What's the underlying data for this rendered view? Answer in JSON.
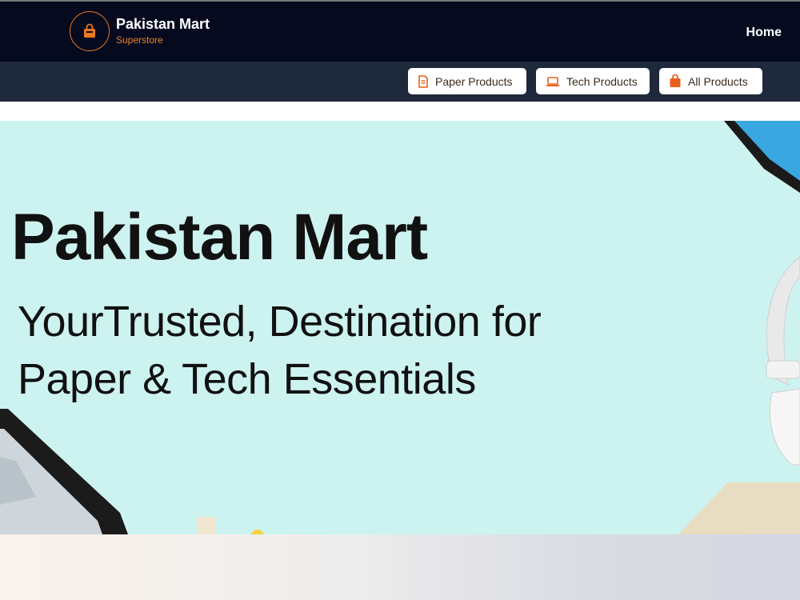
{
  "brand": {
    "name": "Pakistan Mart",
    "tagline": "Superstore",
    "logo_icon": "shopping-bag-icon",
    "accent_color": "#f0851f"
  },
  "nav": {
    "home_label": "Home"
  },
  "categories": [
    {
      "label": "Paper Products",
      "icon": "document-icon"
    },
    {
      "label": "Tech Products",
      "icon": "laptop-icon"
    },
    {
      "label": "All Products",
      "icon": "shopping-bag-icon"
    }
  ],
  "hero": {
    "title": "Pakistan Mart",
    "line1": "YourTrusted, Destination for",
    "line2": "Paper & Tech Essentials",
    "background_color": "#cdf3f0"
  }
}
